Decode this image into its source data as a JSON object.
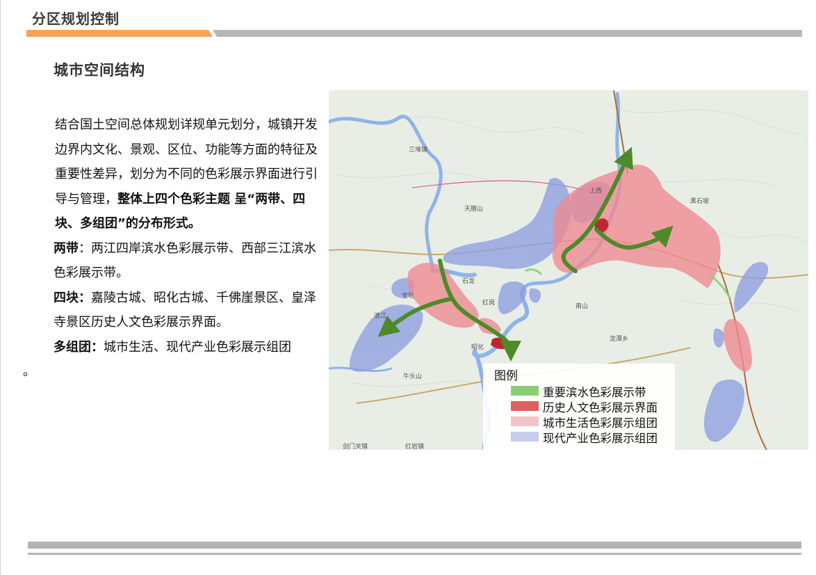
{
  "header": {
    "title": "分区规划控制",
    "accent_color": "#f7a25c",
    "bar_color": "#b7b7b7"
  },
  "section": {
    "title": "城市空间结构"
  },
  "body": {
    "p1_normal": "结合国土空间总体规划详规单元划分，城镇开发边界内文化、景观、区位、功能等方面的特征及重要性差异，划分为不同的色彩展示界面进行引导与管理，",
    "p1_bold": "整体上四个色彩主题 呈“两带、四块、多组团”的分布形式。",
    "p2_label": "两带",
    "p2_text": "：两江四岸滨水色彩展示带、西部三江滨水色彩展示带。",
    "p3_label": "四块：",
    "p3_text": "嘉陵古城、昭化古城、千佛崖景区、皇泽寺景区历史人文色彩展示界面。",
    "p4_label": "多组团：",
    "p4_text": "城市生活、现代产业色彩展示组团",
    "p4_tail": "。"
  },
  "map": {
    "labels": {
      "tianyi": "天膳山",
      "sanduizhen": "三堆镇",
      "heishipo": "黑石坡",
      "nanshan": "南山",
      "niutoushan": "牛头山",
      "zhaohua": "昭化",
      "shilong": "石龙",
      "baolun": "宝轮",
      "qingjiang": "清江",
      "honggang": "红岗",
      "longtan": "龙潭乡",
      "shangxi": "上西",
      "jianmen": "剑门关镇",
      "hongyan": "红岩镇"
    },
    "colors": {
      "waterfront": "#8ccf72",
      "historic": "#d9534f",
      "living": "#f2a8ad",
      "industry": "#8e9fe0",
      "water": "#8fb3e8",
      "arrow": "#4e8a2a"
    },
    "legend": {
      "title": "图例",
      "items": [
        {
          "label": "重要滨水色彩展示带",
          "color": "#8ccf72"
        },
        {
          "label": "历史人文色彩展示界面",
          "color": "#e06060"
        },
        {
          "label": "城市生活色彩展示组团",
          "color": "#f2c4c8"
        },
        {
          "label": "现代产业色彩展示组团",
          "color": "#c5cdeb"
        }
      ]
    }
  }
}
